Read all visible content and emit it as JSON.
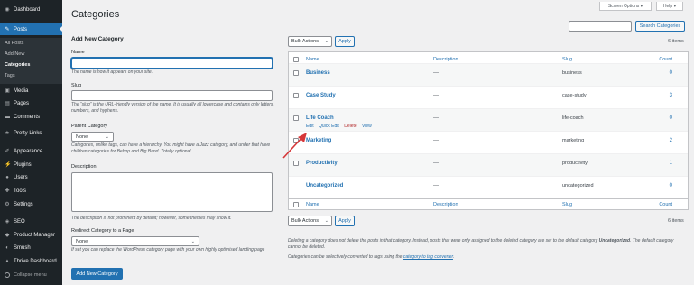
{
  "page": {
    "title": "Categories"
  },
  "top": {
    "screen_options": "Screen Options ▾",
    "help": "Help ▾"
  },
  "sidebar": {
    "dashboard": "Dashboard",
    "posts": "Posts",
    "posts_sub": [
      "All Posts",
      "Add New",
      "Categories",
      "Tags"
    ],
    "media": "Media",
    "pages": "Pages",
    "comments": "Comments",
    "pretty_links": "Pretty Links",
    "appearance": "Appearance",
    "plugins": "Plugins",
    "users": "Users",
    "tools": "Tools",
    "settings": "Settings",
    "seo": "SEO",
    "product_manager": "Product Manager",
    "smush": "Smush",
    "thrive_dashboard": "Thrive Dashboard",
    "collapse": "Collapse menu"
  },
  "form": {
    "heading": "Add New Category",
    "name_label": "Name",
    "name_help": "The name is how it appears on your site.",
    "slug_label": "Slug",
    "slug_help": "The “slug” is the URL-friendly version of the name. It is usually all lowercase and contains only letters, numbers, and hyphens.",
    "parent_label": "Parent Category",
    "parent_value": "None",
    "parent_help": "Categories, unlike tags, can have a hierarchy. You might have a Jazz category, and under that have children categories for Bebop and Big Band. Totally optional.",
    "desc_label": "Description",
    "desc_help": "The description is not prominent by default; however, some themes may show it.",
    "redirect_label": "Redirect Category to a Page",
    "redirect_value": "None",
    "redirect_help": "If set you can replace the WordPress category page with your own highly optimised landing page",
    "submit": "Add New Category"
  },
  "list": {
    "search_button": "Search Categories",
    "bulk_actions": "Bulk Actions",
    "apply": "Apply",
    "items_count": "6 items",
    "columns": {
      "name": "Name",
      "description": "Description",
      "slug": "Slug",
      "count": "Count"
    },
    "rows": [
      {
        "name": "Business",
        "description": "—",
        "slug": "business",
        "count": "0"
      },
      {
        "name": "Case Study",
        "description": "—",
        "slug": "case-study",
        "count": "3"
      },
      {
        "name": "Life Coach",
        "description": "—",
        "slug": "life-coach",
        "count": "0"
      },
      {
        "name": "Marketing",
        "description": "—",
        "slug": "marketing",
        "count": "2"
      },
      {
        "name": "Productivity",
        "description": "—",
        "slug": "productivity",
        "count": "1"
      },
      {
        "name": "Uncategorized",
        "description": "—",
        "slug": "uncategorized",
        "count": "0"
      }
    ],
    "row_actions": {
      "edit": "Edit",
      "quick_edit": "Quick Edit",
      "delete": "Delete",
      "view": "View"
    },
    "note1": "Deleting a category does not delete the posts in that category. Instead, posts that were only assigned to the deleted category are set to the default category",
    "note1b": "Uncategorized",
    "note1c": ". The default category cannot be deleted.",
    "note2": "Categories can be selectively converted to tags using the",
    "note2_link": "category to tag converter",
    "note2_end": "."
  },
  "colors": {
    "sidebar": "#1d2327",
    "accent": "#2271b1",
    "delete": "#b32d2e",
    "arrow": "#d63638"
  }
}
